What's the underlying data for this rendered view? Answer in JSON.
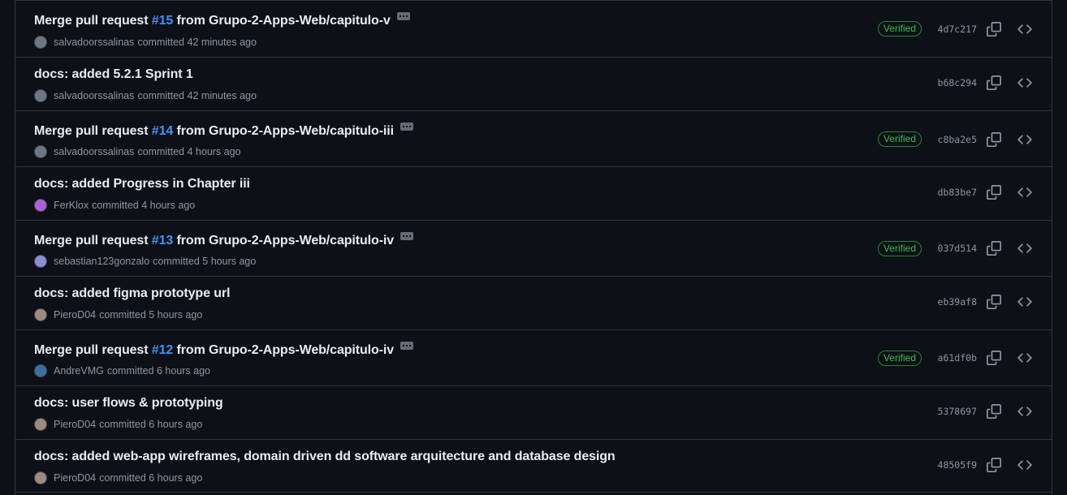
{
  "colors": {
    "background": "#0d1117",
    "border": "#30363d",
    "text_primary": "#e6edf3",
    "text_muted": "#8d96a0",
    "link": "#4493f8",
    "verified_green": "#3fb950"
  },
  "commits": [
    {
      "title_before": "Merge pull request ",
      "pr": "#15",
      "title_after": " from Grupo-2-Apps-Web/capitulo-v",
      "author": "salvadoorssalinas",
      "action": "committed 42 minutes ago",
      "verified": "Verified",
      "sha": "4d7c217",
      "avatar_color": "#6e7681"
    },
    {
      "title_before": "docs: added 5.2.1 Sprint 1",
      "pr": "",
      "title_after": "",
      "author": "salvadoorssalinas",
      "action": "committed 42 minutes ago",
      "verified": "",
      "sha": "b68c294",
      "avatar_color": "#6e7681"
    },
    {
      "title_before": "Merge pull request ",
      "pr": "#14",
      "title_after": " from Grupo-2-Apps-Web/capitulo-iii",
      "author": "salvadoorssalinas",
      "action": "committed 4 hours ago",
      "verified": "Verified",
      "sha": "c8ba2e5",
      "avatar_color": "#6e7681"
    },
    {
      "title_before": "docs: added Progress in Chapter iii",
      "pr": "",
      "title_after": "",
      "author": "FerKlox",
      "action": "committed 4 hours ago",
      "verified": "",
      "sha": "db83be7",
      "avatar_color": "#b15fd9"
    },
    {
      "title_before": "Merge pull request ",
      "pr": "#13",
      "title_after": " from Grupo-2-Apps-Web/capitulo-iv",
      "author": "sebastian123gonzalo",
      "action": "committed 5 hours ago",
      "verified": "Verified",
      "sha": "037d514",
      "avatar_color": "#8b8fd6"
    },
    {
      "title_before": "docs: added figma prototype url",
      "pr": "",
      "title_after": "",
      "author": "PieroD04",
      "action": "committed 5 hours ago",
      "verified": "",
      "sha": "eb39af8",
      "avatar_color": "#9e8a7e"
    },
    {
      "title_before": "Merge pull request ",
      "pr": "#12",
      "title_after": " from Grupo-2-Apps-Web/capitulo-iv",
      "author": "AndreVMG",
      "action": "committed 6 hours ago",
      "verified": "Verified",
      "sha": "a61df0b",
      "avatar_color": "#3b6ea5"
    },
    {
      "title_before": "docs: user flows & prototyping",
      "pr": "",
      "title_after": "",
      "author": "PieroD04",
      "action": "committed 6 hours ago",
      "verified": "",
      "sha": "5378697",
      "avatar_color": "#9e8a7e"
    },
    {
      "title_before": "docs: added web-app wireframes, domain driven dd software arquitecture and database design",
      "pr": "",
      "title_after": "",
      "author": "PieroD04",
      "action": "committed 6 hours ago",
      "verified": "",
      "sha": "48505f9",
      "avatar_color": "#9e8a7e"
    }
  ]
}
